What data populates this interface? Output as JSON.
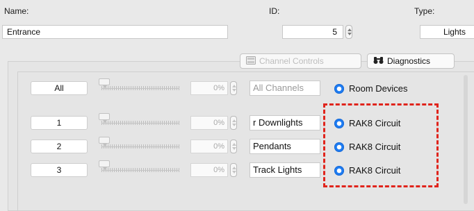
{
  "header": {
    "name_label": "Name:",
    "id_label": "ID:",
    "type_label": "Type:",
    "name_value": "Entrance",
    "id_value": "5",
    "type_value": "Lights"
  },
  "tabs": [
    {
      "label": "Channel Controls",
      "icon": "channel-controls-icon",
      "active": false
    },
    {
      "label": "Diagnostics",
      "icon": "binoculars-icon",
      "active": true
    }
  ],
  "all_row": {
    "button": "All",
    "level_percent": 0,
    "level_text": "0%",
    "name": "All Channels",
    "target": "Room Devices"
  },
  "channels": [
    {
      "button": "1",
      "level_percent": 0,
      "level_text": "0%",
      "name": "r Downlights",
      "target": "RAK8 Circuit"
    },
    {
      "button": "2",
      "level_percent": 0,
      "level_text": "0%",
      "name": "Pendants",
      "target": "RAK8 Circuit"
    },
    {
      "button": "3",
      "level_percent": 0,
      "level_text": "0%",
      "name": "Track Lights",
      "target": "RAK8 Circuit"
    }
  ],
  "colors": {
    "highlight_dash": "#e0241c",
    "radio_accent": "#1e7cf2"
  }
}
